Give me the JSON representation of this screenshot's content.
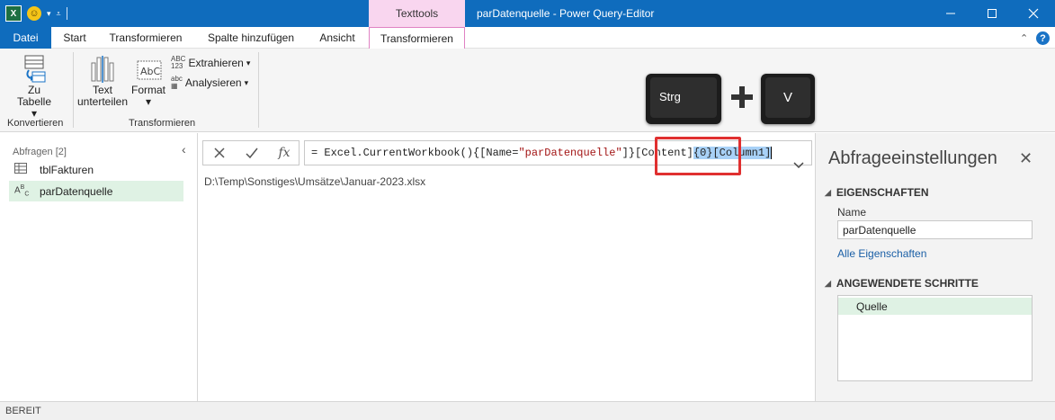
{
  "window": {
    "title": "parDatenquelle - Power Query-Editor",
    "contextual_tab": "Texttools",
    "title_bar_color": "#0f6cbd"
  },
  "qat": {
    "app_icon": "excel-icon",
    "app_icon_letter": "X",
    "smiley_icon": "smile-icon"
  },
  "tabs": {
    "file": "Datei",
    "start": "Start",
    "transform": "Transformieren",
    "add_column": "Spalte hinzufügen",
    "view": "Ansicht",
    "context_transform": "Transformieren"
  },
  "ribbon": {
    "to_table_line1": "Zu",
    "to_table_line2": "Tabelle",
    "convert_group": "Konvertieren",
    "split_line1": "Text",
    "split_line2": "unterteilen",
    "format": "Format",
    "extract": "Extrahieren",
    "analyze": "Analysieren",
    "transform_group": "Transformieren"
  },
  "shortcut_overlay": {
    "key1": "Strg",
    "plus": "+",
    "key2": "V"
  },
  "left_pane": {
    "header": "Abfragen [2]",
    "items": [
      {
        "label": "tblFakturen",
        "icon": "table-icon"
      },
      {
        "label": "parDatenquelle",
        "icon": "text-type-icon",
        "icon_text": "ABC"
      }
    ]
  },
  "formula_bar": {
    "prefix": "= Excel.CurrentWorkbook(){[Name=",
    "string": "\"parDatenquelle\"",
    "middle": "]}[Content]",
    "selected": "{0}[Column1]"
  },
  "result": {
    "value": "D:\\Temp\\Sonstiges\\Umsätze\\Januar-2023.xlsx"
  },
  "right_pane": {
    "title": "Abfrageeinstellungen",
    "properties_header": "EIGENSCHAFTEN",
    "name_label": "Name",
    "name_value": "parDatenquelle",
    "all_properties_link": "Alle Eigenschaften",
    "steps_header": "ANGEWENDETE SCHRITTE",
    "steps": [
      "Quelle"
    ]
  },
  "status": {
    "text": "BEREIT"
  },
  "colors": {
    "accent": "#0f6cbd",
    "selection_green": "#dff2e4",
    "context_pink": "#f9d6ef",
    "highlight_red": "#e03030"
  }
}
